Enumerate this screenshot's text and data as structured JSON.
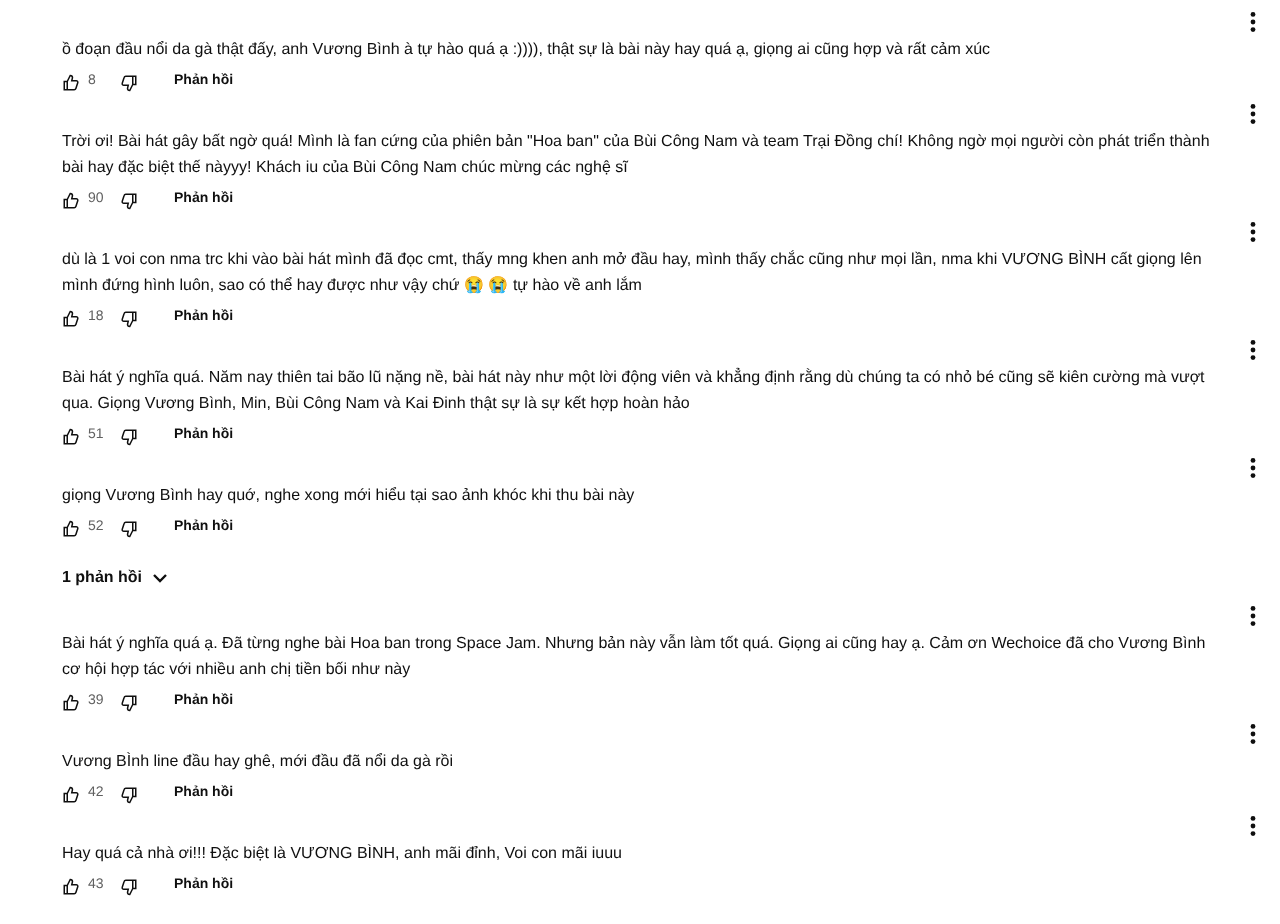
{
  "items": [
    {
      "kind": "comment",
      "text": "ồ đoạn đầu nổi da gà thật đấy, anh Vương Bình à tự hào quá ạ :)))), thật sự là bài này hay quá ạ, giọng ai cũng hợp và rất cảm xúc",
      "likes": "8",
      "reply": "Phản hồi"
    },
    {
      "kind": "comment",
      "text": "Trời ơi! Bài hát gây bất ngờ quá! Mình là fan cứng của phiên bản \"Hoa ban\" của Bùi Công Nam và team Trại Đồng chí! Không ngờ mọi người còn phát triển thành bài hay đặc biệt thế nàyyy! Khách iu của Bùi Công Nam chúc mừng các nghệ sĩ",
      "likes": "90",
      "reply": "Phản hồi"
    },
    {
      "kind": "comment",
      "text": "dù là 1 voi con nma trc khi vào bài hát mình đã đọc cmt, thấy mng khen anh mở đầu hay, mình thấy chắc cũng như mọi lần, nma khi VƯƠNG BÌNH cất giọng lên mình đứng hình luôn, sao có thể hay được như vậy chứ 😭 😭 tự hào về anh lắm",
      "likes": "18",
      "reply": "Phản hồi"
    },
    {
      "kind": "comment",
      "text": "Bài hát ý nghĩa quá. Năm nay thiên tai bão lũ nặng nề, bài hát này như một lời động viên và khẳng định rằng dù chúng ta có nhỏ bé cũng sẽ kiên cường mà vượt qua. Giọng Vương Bình, Min, Bùi Công Nam và Kai Đinh thật sự là sự kết hợp hoàn hảo",
      "likes": "51",
      "reply": "Phản hồi"
    },
    {
      "kind": "comment",
      "text": "giọng Vương Bình hay quớ, nghe xong mới hiểu tại sao ảnh khóc khi thu bài này",
      "likes": "52",
      "reply": "Phản hồi"
    },
    {
      "kind": "replies_toggle",
      "label": "1 phản hồi",
      "expanded": false
    },
    {
      "kind": "comment",
      "text": "Bài hát ý nghĩa quá ạ. Đã từng nghe bài Hoa ban trong Space Jam. Nhưng bản này vẫn làm tốt quá. Giọng ai cũng hay ạ. Cảm ơn Wechoice đã cho Vương Bình cơ hội hợp tác với nhiều anh chị tiền bối như này",
      "likes": "39",
      "reply": "Phản hồi"
    },
    {
      "kind": "comment",
      "text": "Vương BÌnh line đầu hay ghê, mới đầu đã nổi da gà rồi",
      "likes": "42",
      "reply": "Phản hồi"
    },
    {
      "kind": "comment",
      "text": "Hay quá cả nhà ơi!!! Đặc biệt là VƯƠNG BÌNH, anh mãi đỉnh, Voi con mãi iuuu",
      "likes": "43",
      "reply": "Phản hồi"
    }
  ]
}
